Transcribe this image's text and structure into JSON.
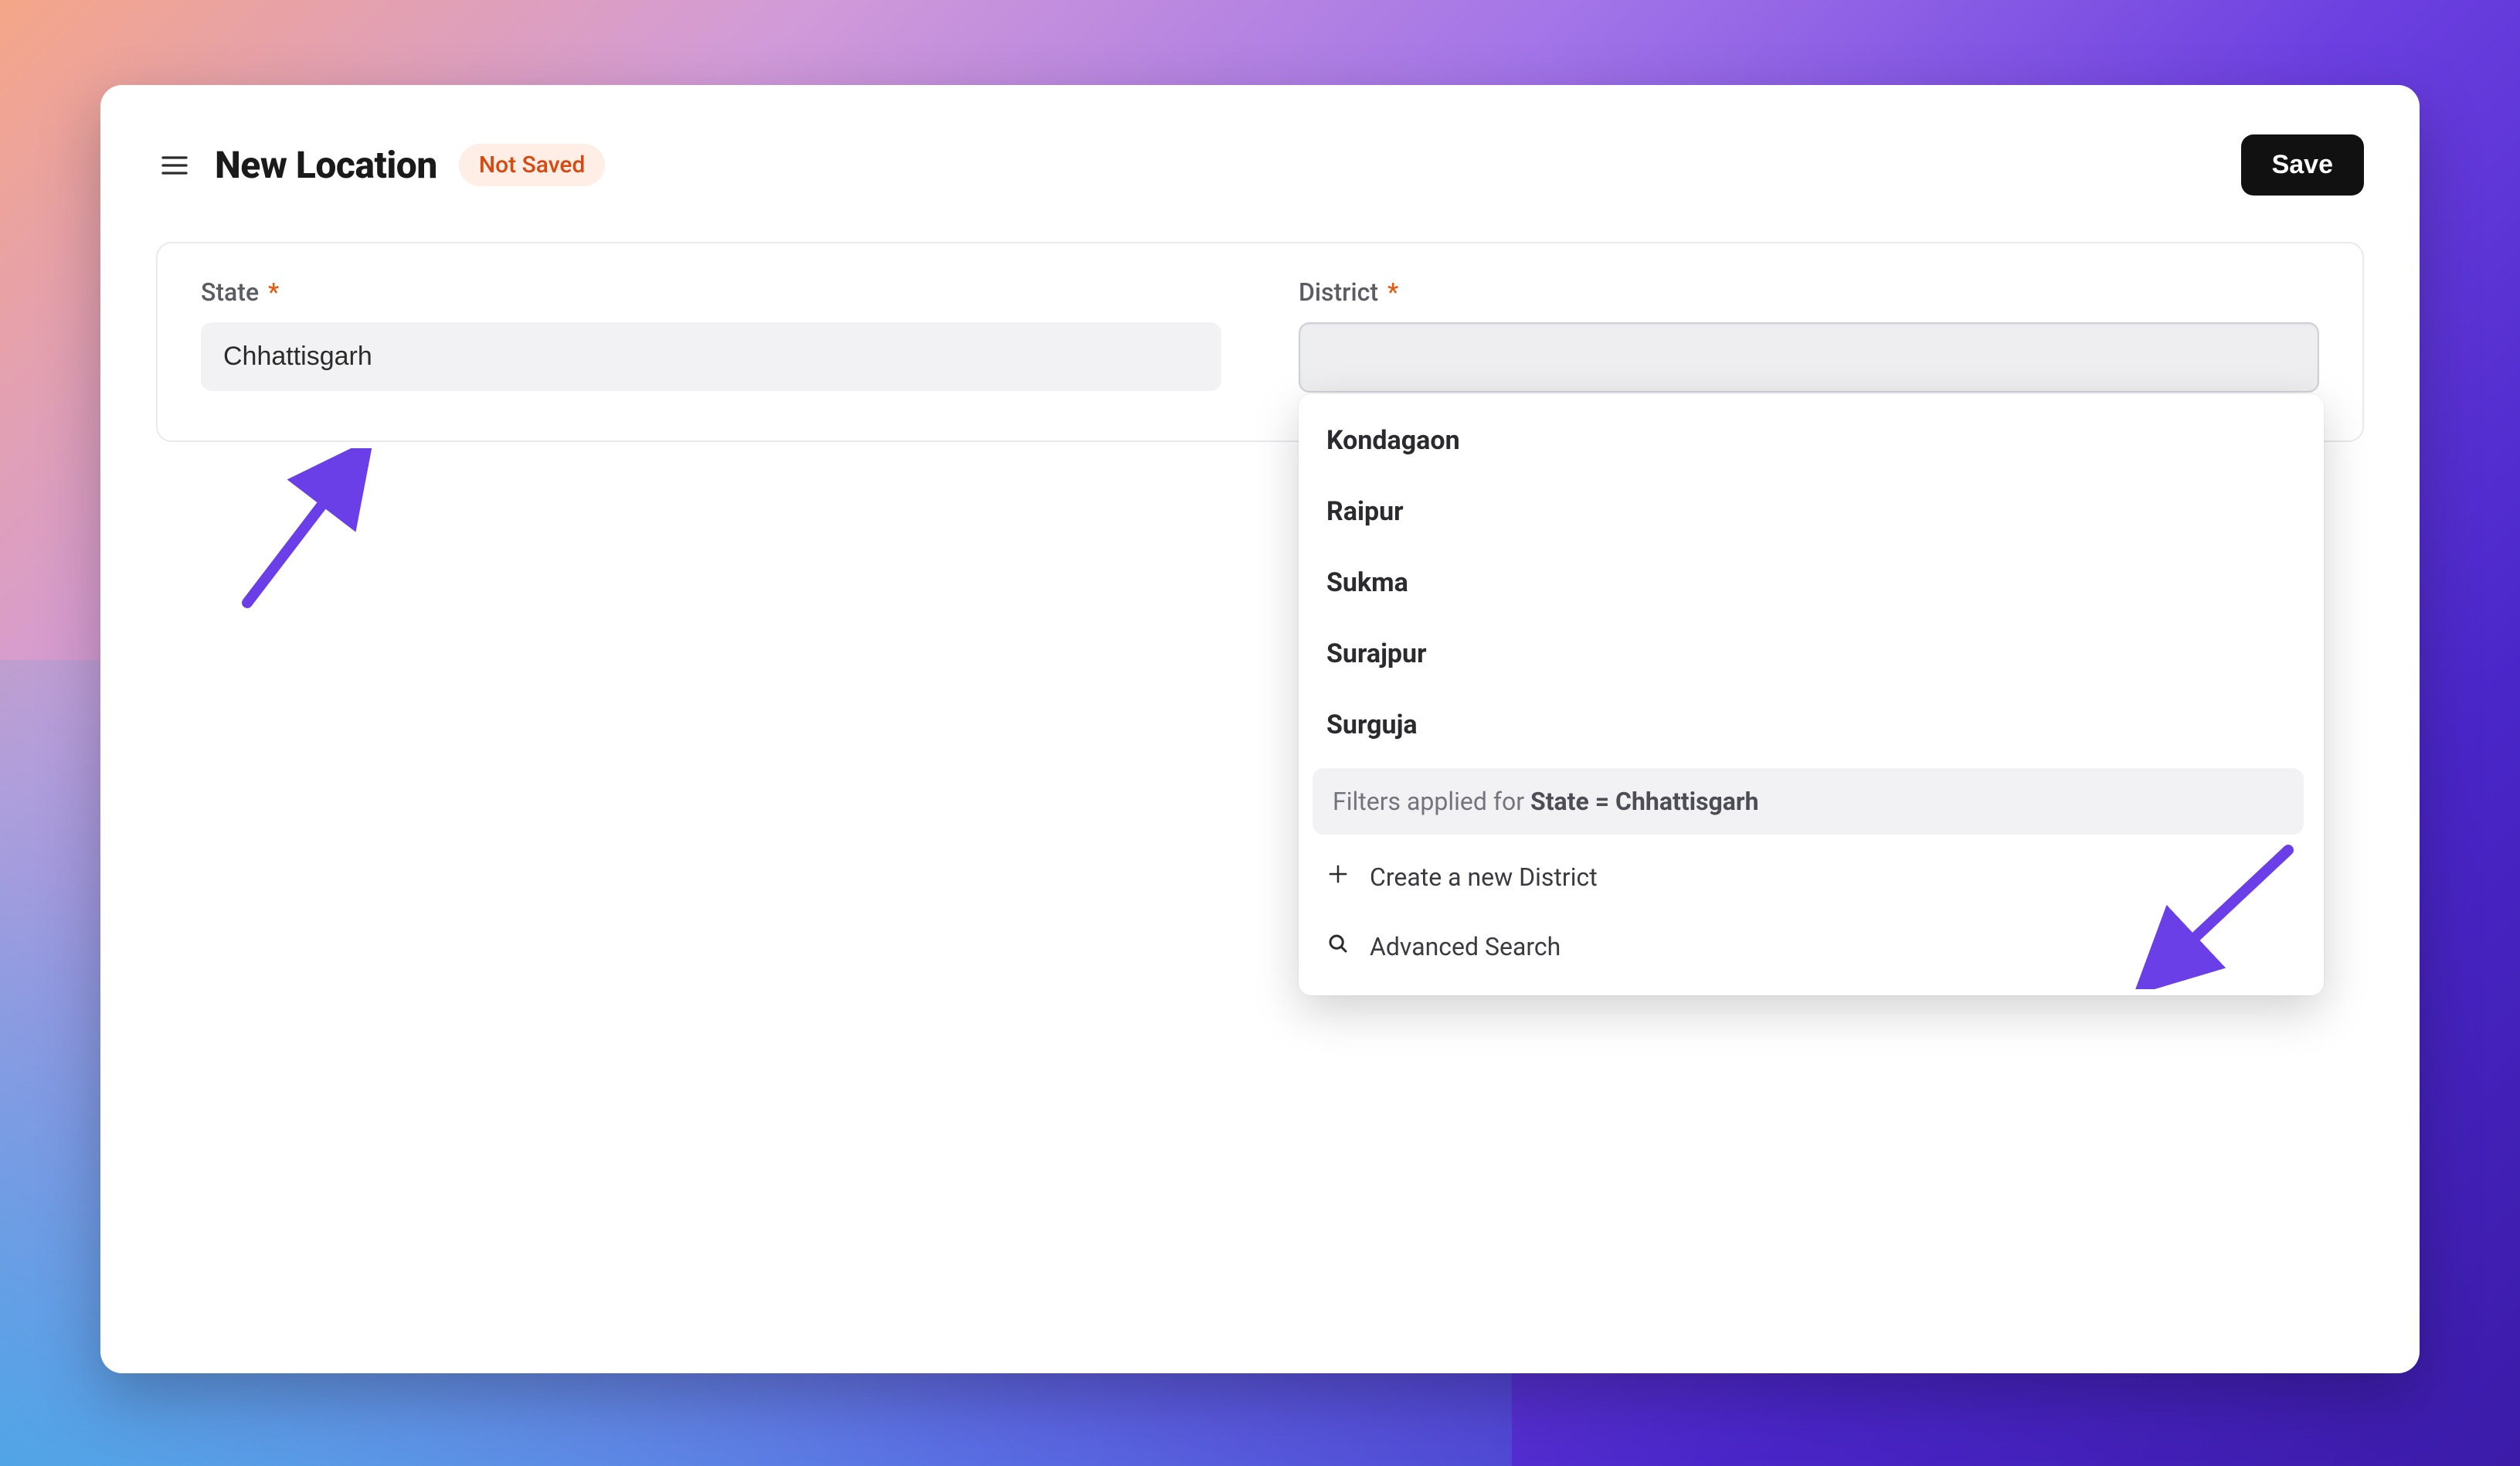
{
  "header": {
    "title": "New Location",
    "status_badge": "Not Saved",
    "save_label": "Save"
  },
  "form": {
    "state": {
      "label": "State",
      "required_marker": "*",
      "value": "Chhattisgarh"
    },
    "district": {
      "label": "District",
      "required_marker": "*",
      "value": "",
      "dropdown": {
        "options": [
          "Kondagaon",
          "Raipur",
          "Sukma",
          "Surajpur",
          "Surguja"
        ],
        "filter_prefix": "Filters applied for ",
        "filter_condition": "State = Chhattisgarh",
        "create_label": "Create a new District",
        "advanced_label": "Advanced Search"
      }
    }
  }
}
